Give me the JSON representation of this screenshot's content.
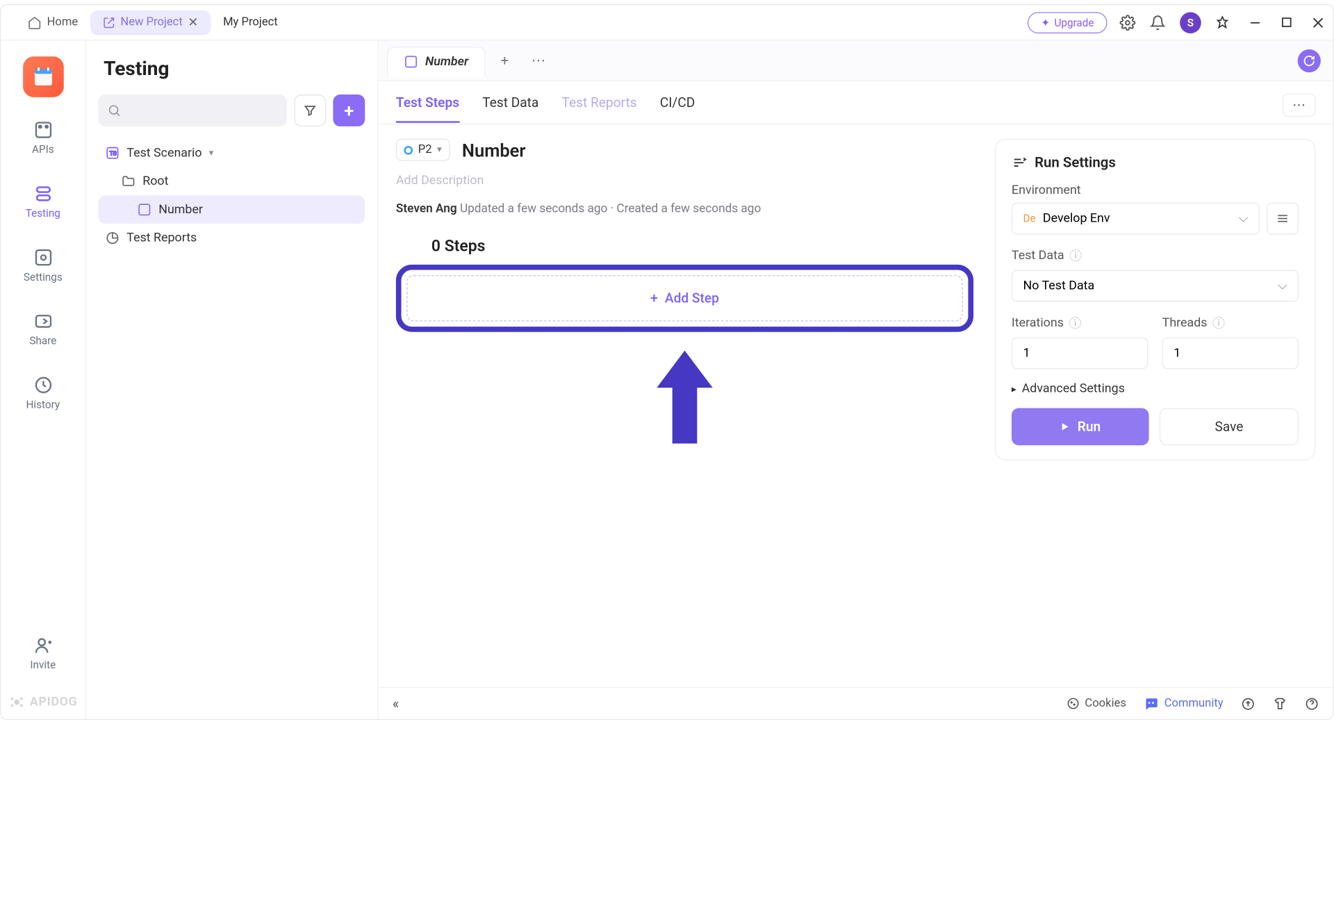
{
  "titlebar": {
    "home": "Home",
    "active_project": "New Project",
    "other_project": "My Project",
    "upgrade": "Upgrade",
    "avatar_letter": "S"
  },
  "rail": {
    "apis": "APIs",
    "testing": "Testing",
    "settings": "Settings",
    "share": "Share",
    "history": "History",
    "invite": "Invite",
    "brand": "APIDOG"
  },
  "sidebar": {
    "title": "Testing",
    "tree": {
      "scenario": "Test Scenario",
      "root": "Root",
      "number": "Number",
      "reports": "Test Reports"
    }
  },
  "main": {
    "doc_tab": "Number",
    "subnav": {
      "steps": "Test Steps",
      "data": "Test Data",
      "reports": "Test Reports",
      "cicd": "CI/CD"
    },
    "priority": "P2",
    "title": "Number",
    "description_placeholder": "Add Description",
    "author": "Steven Ang",
    "meta_rest": "Updated a few seconds ago · Created a few seconds ago",
    "steps_count": "0 Steps",
    "add_step": "Add Step"
  },
  "run_settings": {
    "heading": "Run Settings",
    "env_label": "Environment",
    "env_value": "Develop Env",
    "env_badge": "De",
    "testdata_label": "Test Data",
    "testdata_value": "No Test Data",
    "iterations_label": "Iterations",
    "iterations_value": "1",
    "threads_label": "Threads",
    "threads_value": "1",
    "advanced": "Advanced Settings",
    "run": "Run",
    "save": "Save"
  },
  "footer": {
    "cookies": "Cookies",
    "community": "Community"
  }
}
